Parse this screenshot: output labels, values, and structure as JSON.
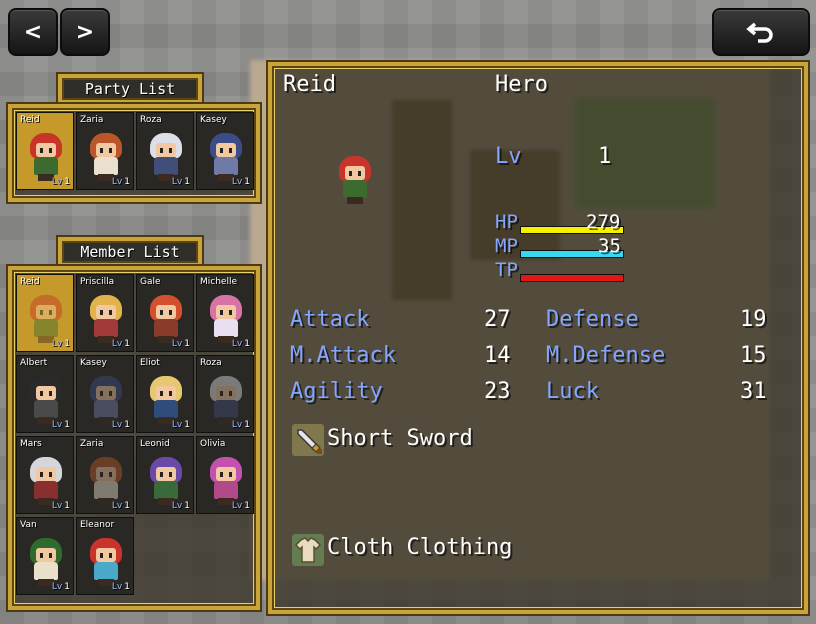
{
  "nav": {
    "prev_label": "<",
    "next_label": ">",
    "back_icon": "back-arrow-icon"
  },
  "party_list": {
    "title": "Party List",
    "members": [
      {
        "name": "Reid",
        "lv_label": "Lv",
        "lv": "1",
        "hair": "#c8342a",
        "body": "#3c6a2f",
        "selected": true,
        "dim": false
      },
      {
        "name": "Zaria",
        "lv_label": "Lv",
        "lv": "1",
        "hair": "#b9572a",
        "body": "#e9e0d0",
        "selected": false,
        "dim": false
      },
      {
        "name": "Roza",
        "lv_label": "Lv",
        "lv": "1",
        "hair": "#dcdfe6",
        "body": "#3f4f7a",
        "selected": false,
        "dim": false
      },
      {
        "name": "Kasey",
        "lv_label": "Lv",
        "lv": "1",
        "hair": "#3c4c86",
        "body": "#6f7aa8",
        "selected": false,
        "dim": false
      }
    ]
  },
  "member_list": {
    "title": "Member List",
    "members": [
      {
        "name": "Reid",
        "lv_label": "Lv",
        "lv": "1",
        "hair": "#c8342a",
        "body": "#3c6a2f",
        "selected": true,
        "dim": true
      },
      {
        "name": "Priscilla",
        "lv_label": "Lv",
        "lv": "1",
        "hair": "#e1b34a",
        "body": "#a23a3a",
        "selected": false,
        "dim": false
      },
      {
        "name": "Gale",
        "lv_label": "Lv",
        "lv": "1",
        "hair": "#d2502e",
        "body": "#8a3b2a",
        "selected": false,
        "dim": false
      },
      {
        "name": "Michelle",
        "lv_label": "Lv",
        "lv": "1",
        "hair": "#d873a7",
        "body": "#e8e0f0",
        "selected": false,
        "dim": false
      },
      {
        "name": "Albert",
        "lv_label": "Lv",
        "lv": "1",
        "hair": "#2a2a2a",
        "body": "#4a4a4a",
        "selected": false,
        "dim": false
      },
      {
        "name": "Kasey",
        "lv_label": "Lv",
        "lv": "1",
        "hair": "#3c4c86",
        "body": "#6f7aa8",
        "selected": false,
        "dim": true
      },
      {
        "name": "Eliot",
        "lv_label": "Lv",
        "lv": "1",
        "hair": "#e6c873",
        "body": "#2f4c7a",
        "selected": false,
        "dim": false
      },
      {
        "name": "Roza",
        "lv_label": "Lv",
        "lv": "1",
        "hair": "#dcdfe6",
        "body": "#3f4f7a",
        "selected": false,
        "dim": true
      },
      {
        "name": "Mars",
        "lv_label": "Lv",
        "lv": "1",
        "hair": "#d4d6dc",
        "body": "#8a2f2f",
        "selected": false,
        "dim": false
      },
      {
        "name": "Zaria",
        "lv_label": "Lv",
        "lv": "1",
        "hair": "#b9572a",
        "body": "#e9e0d0",
        "selected": false,
        "dim": true
      },
      {
        "name": "Leonid",
        "lv_label": "Lv",
        "lv": "1",
        "hair": "#6a4aa8",
        "body": "#3a6a3a",
        "selected": false,
        "dim": false
      },
      {
        "name": "Olivia",
        "lv_label": "Lv",
        "lv": "1",
        "hair": "#c450b0",
        "body": "#b04a8a",
        "selected": false,
        "dim": false
      },
      {
        "name": "Van",
        "lv_label": "Lv",
        "lv": "1",
        "hair": "#2f6a2f",
        "body": "#e8e0c8",
        "selected": false,
        "dim": false
      },
      {
        "name": "Eleanor",
        "lv_label": "Lv",
        "lv": "1",
        "hair": "#c8342a",
        "body": "#4aa8c8",
        "selected": false,
        "dim": false
      }
    ]
  },
  "status": {
    "name": "Reid",
    "class": "Hero",
    "lv_label": "Lv",
    "lv": "1",
    "hp_label": "HP",
    "hp": "279",
    "hp_ratio": 1.0,
    "mp_label": "MP",
    "mp": "35",
    "mp_ratio": 1.0,
    "tp_label": "TP",
    "tp_ratio": 1.0,
    "colors": {
      "hp": "#f4f000",
      "mp": "#38d8f0",
      "tp": "#e01818",
      "system": "#84a6ff"
    },
    "params": [
      {
        "label": "Attack",
        "value": "27"
      },
      {
        "label": "Defense",
        "value": "19"
      },
      {
        "label": "M.Attack",
        "value": "14"
      },
      {
        "label": "M.Defense",
        "value": "15"
      },
      {
        "label": "Agility",
        "value": "23"
      },
      {
        "label": "Luck",
        "value": "31"
      }
    ],
    "equips": [
      {
        "name": "Short Sword",
        "icon": "sword-icon"
      },
      {
        "name": "Cloth Clothing",
        "icon": "clothing-icon"
      }
    ]
  }
}
